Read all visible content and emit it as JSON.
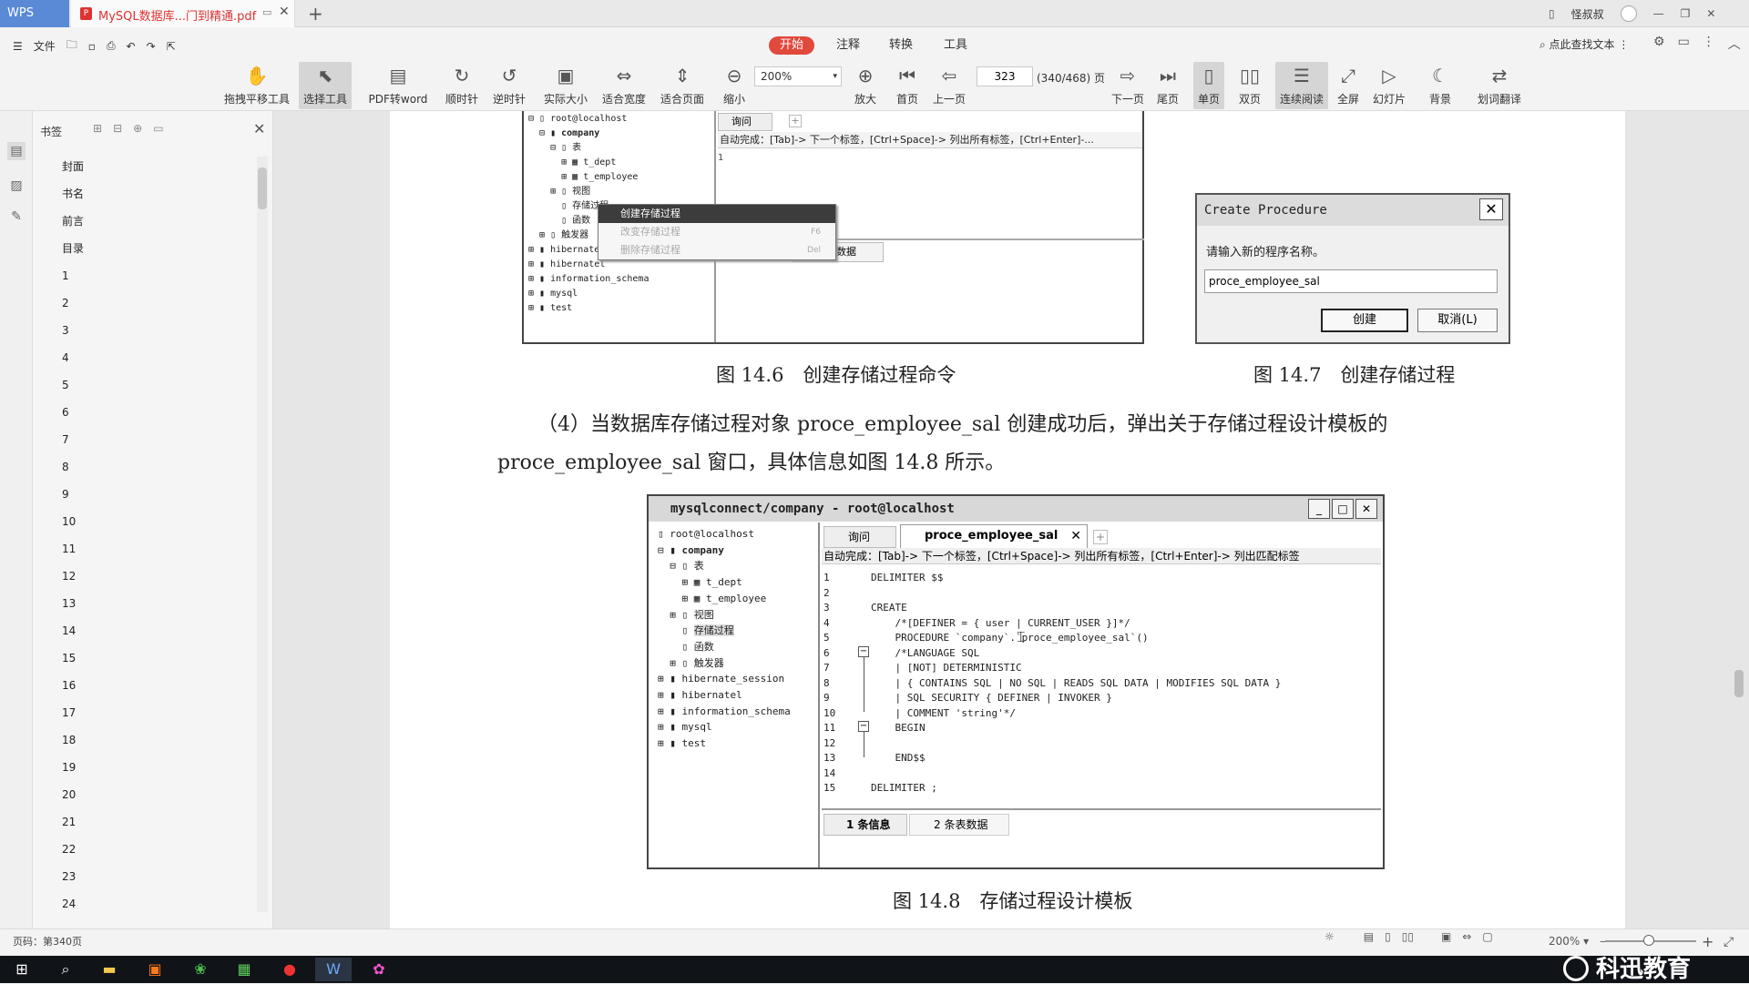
{
  "titlebar": {
    "app": "WPS",
    "doc_tab": "MySQL数据库...门到精通.pdf",
    "user": "怪叔叔"
  },
  "menu": {
    "file": "文件",
    "tabs": [
      "开始",
      "注释",
      "转换",
      "工具"
    ],
    "active_tab": "开始",
    "find_text": "点此查找文本"
  },
  "toolbar": {
    "items": [
      "拖拽平移工具",
      "选择工具",
      "PDF转word",
      "顺时针",
      "逆时针",
      "实际大小",
      "适合宽度",
      "适合页面",
      "缩小",
      "放大",
      "首页",
      "上一页",
      "下一页",
      "尾页",
      "单页",
      "双页",
      "连续阅读",
      "全屏",
      "幻灯片",
      "背景",
      "划词翻译"
    ],
    "zoom": "200%",
    "page_input": "323",
    "page_count": "(340/468) 页"
  },
  "bookmarks": {
    "title": "书签",
    "items": [
      "封面",
      "书名",
      "前言",
      "目录",
      "1",
      "2",
      "3",
      "4",
      "5",
      "6",
      "7",
      "8",
      "9",
      "10",
      "11",
      "12",
      "13",
      "14",
      "15",
      "16",
      "17",
      "18",
      "19",
      "20",
      "21",
      "22",
      "23",
      "24"
    ]
  },
  "document": {
    "fig6": {
      "tree": [
        "root@localhost",
        "company",
        "表",
        "t_dept",
        "t_employee",
        "视图",
        "存储过程",
        "函数",
        "触发器",
        "hibernate_session",
        "hibernatel",
        "information_schema",
        "mysql",
        "test"
      ],
      "tab": "询问",
      "autocomplete": "自动完成：[Tab]-> 下一个标签，[Ctrl+Space]-> 列出所有标签，[Ctrl+Enter]-...",
      "line1": "1",
      "context_menu": [
        {
          "label": "创建存储过程",
          "key": ""
        },
        {
          "label": "改变存储过程",
          "key": "F6"
        },
        {
          "label": "删除存储过程",
          "key": "Del"
        }
      ],
      "bottom_tab": "表数据",
      "caption": "图 14.6　创建存储过程命令"
    },
    "fig7": {
      "title": "Create Procedure",
      "label": "请输入新的程序名称。",
      "input_value": "proce_employee_sal",
      "ok": "创建",
      "cancel": "取消(L)",
      "caption": "图 14.7　创建存储过程"
    },
    "paragraph": "（4）当数据库存储过程对象 proce_employee_sal 创建成功后，弹出关于存储过程设计模板的 proce_employee_sal 窗口，具体信息如图 14.8 所示。",
    "fig8": {
      "title": "mysqlconnect/company - root@localhost",
      "tree": [
        "root@localhost",
        "company",
        "表",
        "t_dept",
        "t_employee",
        "视图",
        "存储过程",
        "函数",
        "触发器",
        "hibernate_session",
        "hibernatel",
        "information_schema",
        "mysql",
        "test"
      ],
      "tab1": "询问",
      "tab2": "proce_employee_sal",
      "autocomplete": "自动完成：[Tab]-> 下一个标签，[Ctrl+Space]-> 列出所有标签，[Ctrl+Enter]-> 列出匹配标签",
      "code": [
        {
          "n": "1",
          "t": "DELIMITER $$"
        },
        {
          "n": "2",
          "t": ""
        },
        {
          "n": "3",
          "t": "CREATE"
        },
        {
          "n": "4",
          "t": "    /*[DEFINER = { user | CURRENT_USER }]*/"
        },
        {
          "n": "5",
          "t": "    PROCEDURE `company`.`proce_employee_sal`()"
        },
        {
          "n": "6",
          "t": "    /*LANGUAGE SQL"
        },
        {
          "n": "7",
          "t": "    | [NOT] DETERMINISTIC"
        },
        {
          "n": "8",
          "t": "    | { CONTAINS SQL | NO SQL | READS SQL DATA | MODIFIES SQL DATA }"
        },
        {
          "n": "9",
          "t": "    | SQL SECURITY { DEFINER | INVOKER }"
        },
        {
          "n": "10",
          "t": "    | COMMENT 'string'*/"
        },
        {
          "n": "11",
          "t": "    BEGIN"
        },
        {
          "n": "12",
          "t": ""
        },
        {
          "n": "13",
          "t": "    END$$"
        },
        {
          "n": "14",
          "t": ""
        },
        {
          "n": "15",
          "t": "DELIMITER ;"
        }
      ],
      "bottom_tab1": "1 条信息",
      "bottom_tab2": "2 条表数据",
      "caption": "图 14.8　存储过程设计模板"
    }
  },
  "status": {
    "page_info": "页码：第340页",
    "zoom": "200%"
  },
  "brand": "科迅教育",
  "colors": {
    "accent": "#e0493c",
    "wps_blue": "#5a8ad6",
    "taskbar": "#101418"
  }
}
